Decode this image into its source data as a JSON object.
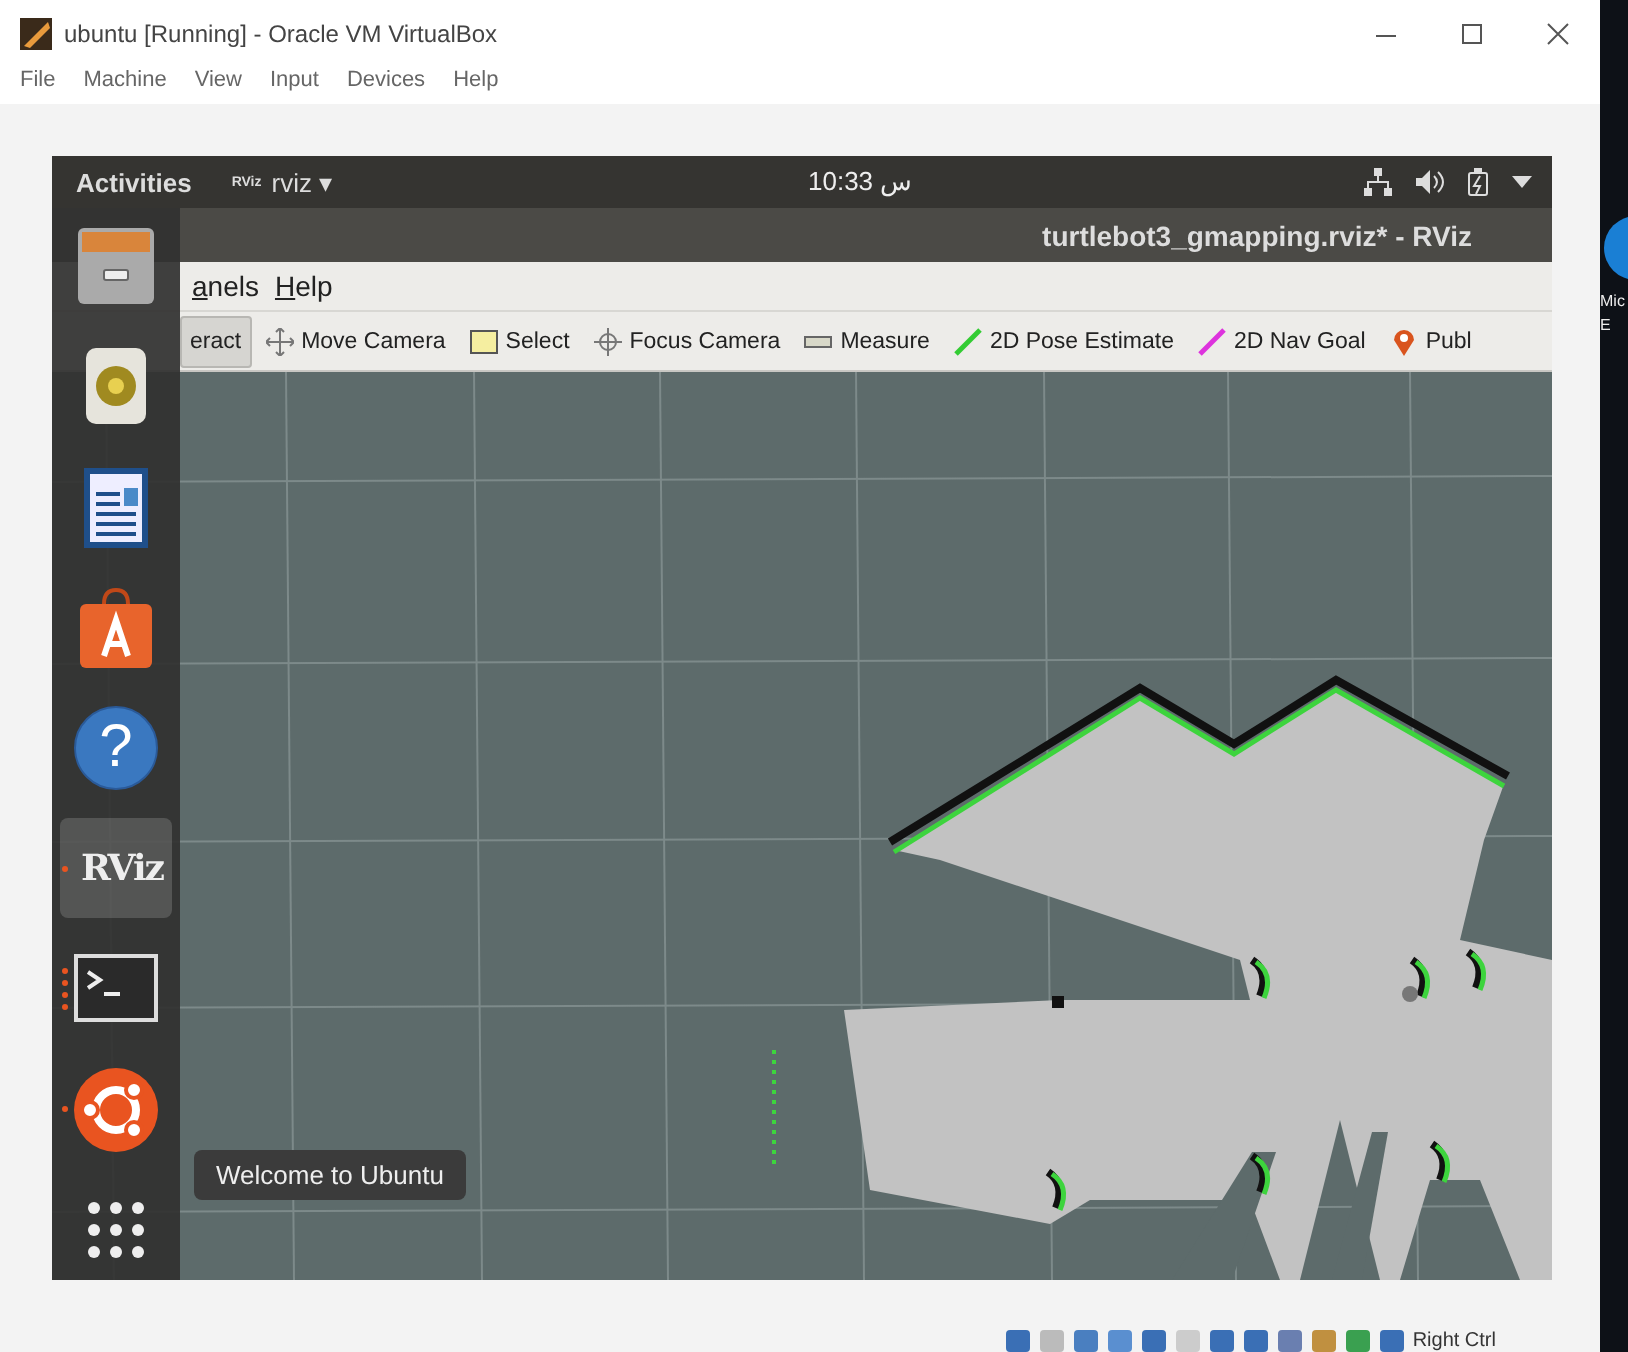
{
  "vbox": {
    "title": "ubuntu [Running] - Oracle VM VirtualBox",
    "menu": [
      "File",
      "Machine",
      "View",
      "Input",
      "Devices",
      "Help"
    ],
    "status_text": "Right Ctrl"
  },
  "desktop": {
    "icon_label": [
      "Mic",
      "E"
    ]
  },
  "topbar": {
    "activities": "Activities",
    "app_badge": "RViz",
    "app": "rviz ▾",
    "clock": "10:33 س"
  },
  "rviz": {
    "title": "turtlebot3_gmapping.rviz* - RViz",
    "menu": [
      "anels",
      "Help"
    ],
    "tools": [
      {
        "label": "eract",
        "kind": "plain",
        "selected": true
      },
      {
        "label": "Move Camera",
        "kind": "move",
        "selected": false
      },
      {
        "label": "Select",
        "kind": "select",
        "selected": false
      },
      {
        "label": "Focus Camera",
        "kind": "focus",
        "selected": false
      },
      {
        "label": "Measure",
        "kind": "measure",
        "selected": false
      },
      {
        "label": "2D Pose Estimate",
        "kind": "pose",
        "selected": false
      },
      {
        "label": "2D Nav Goal",
        "kind": "nav",
        "selected": false
      },
      {
        "label": "Publ",
        "kind": "pin",
        "selected": false
      }
    ]
  },
  "dock": {
    "items": [
      {
        "kind": "files",
        "running": false,
        "multiple_windows": false,
        "selected": false
      },
      {
        "kind": "speaker",
        "running": false,
        "multiple_windows": false,
        "selected": false
      },
      {
        "kind": "document",
        "running": false,
        "multiple_windows": false,
        "selected": false
      },
      {
        "kind": "store",
        "running": false,
        "multiple_windows": false,
        "selected": false
      },
      {
        "kind": "help",
        "glyph": "?",
        "running": false,
        "multiple_windows": false,
        "selected": false
      },
      {
        "kind": "logo",
        "glyph": "RViz",
        "running": true,
        "multiple_windows": false,
        "selected": true
      },
      {
        "kind": "terminal",
        "running": true,
        "multiple_windows": true,
        "selected": false
      },
      {
        "kind": "ubuntu",
        "running": true,
        "multiple_windows": false,
        "selected": false
      },
      {
        "kind": "apps",
        "running": false,
        "multiple_windows": false,
        "selected": false
      }
    ]
  },
  "tooltip": "Welcome to Ubuntu"
}
